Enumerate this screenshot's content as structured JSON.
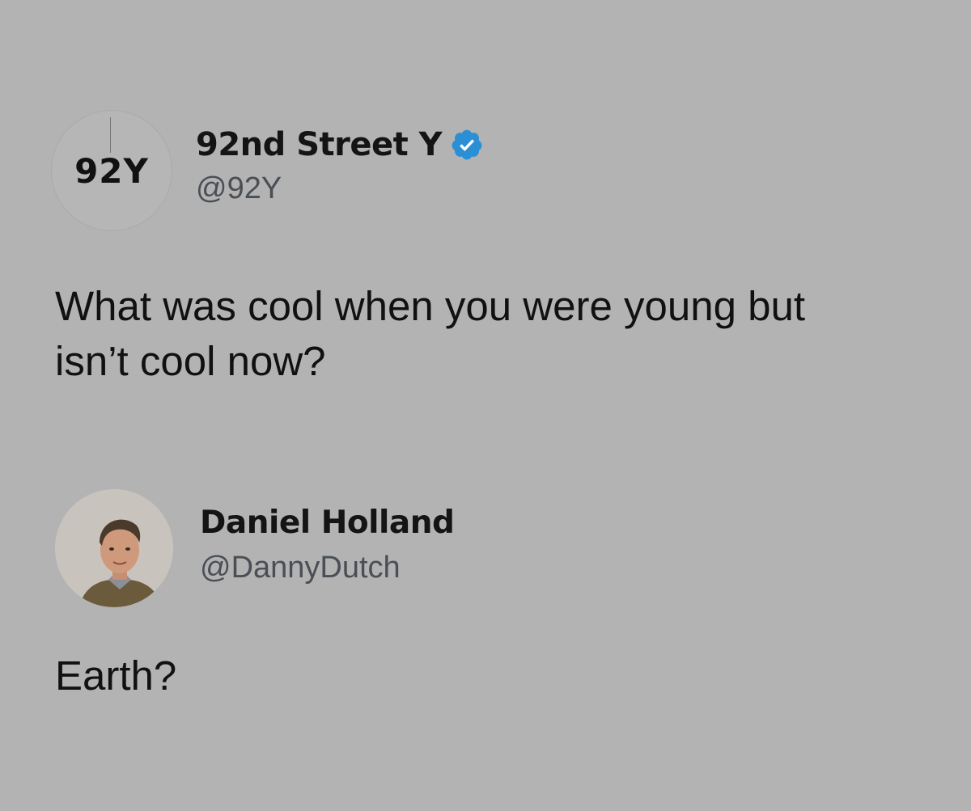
{
  "tweet": {
    "avatar_text": "92Y",
    "display_name": "92nd Street Y",
    "verified": true,
    "handle": "@92Y",
    "text_line1": "What was cool when you were young but",
    "text_line2": "isn’t cool now?"
  },
  "reply": {
    "display_name": "Daniel Holland",
    "handle": "@DannyDutch",
    "text": "Earth?"
  },
  "icons": {
    "verified": "verified-badge-icon",
    "avatar_person": "profile-photo"
  },
  "colors": {
    "background": "#b3b3b3",
    "verified_blue": "#2b8fd6",
    "handle_gray": "#4a4f55"
  }
}
